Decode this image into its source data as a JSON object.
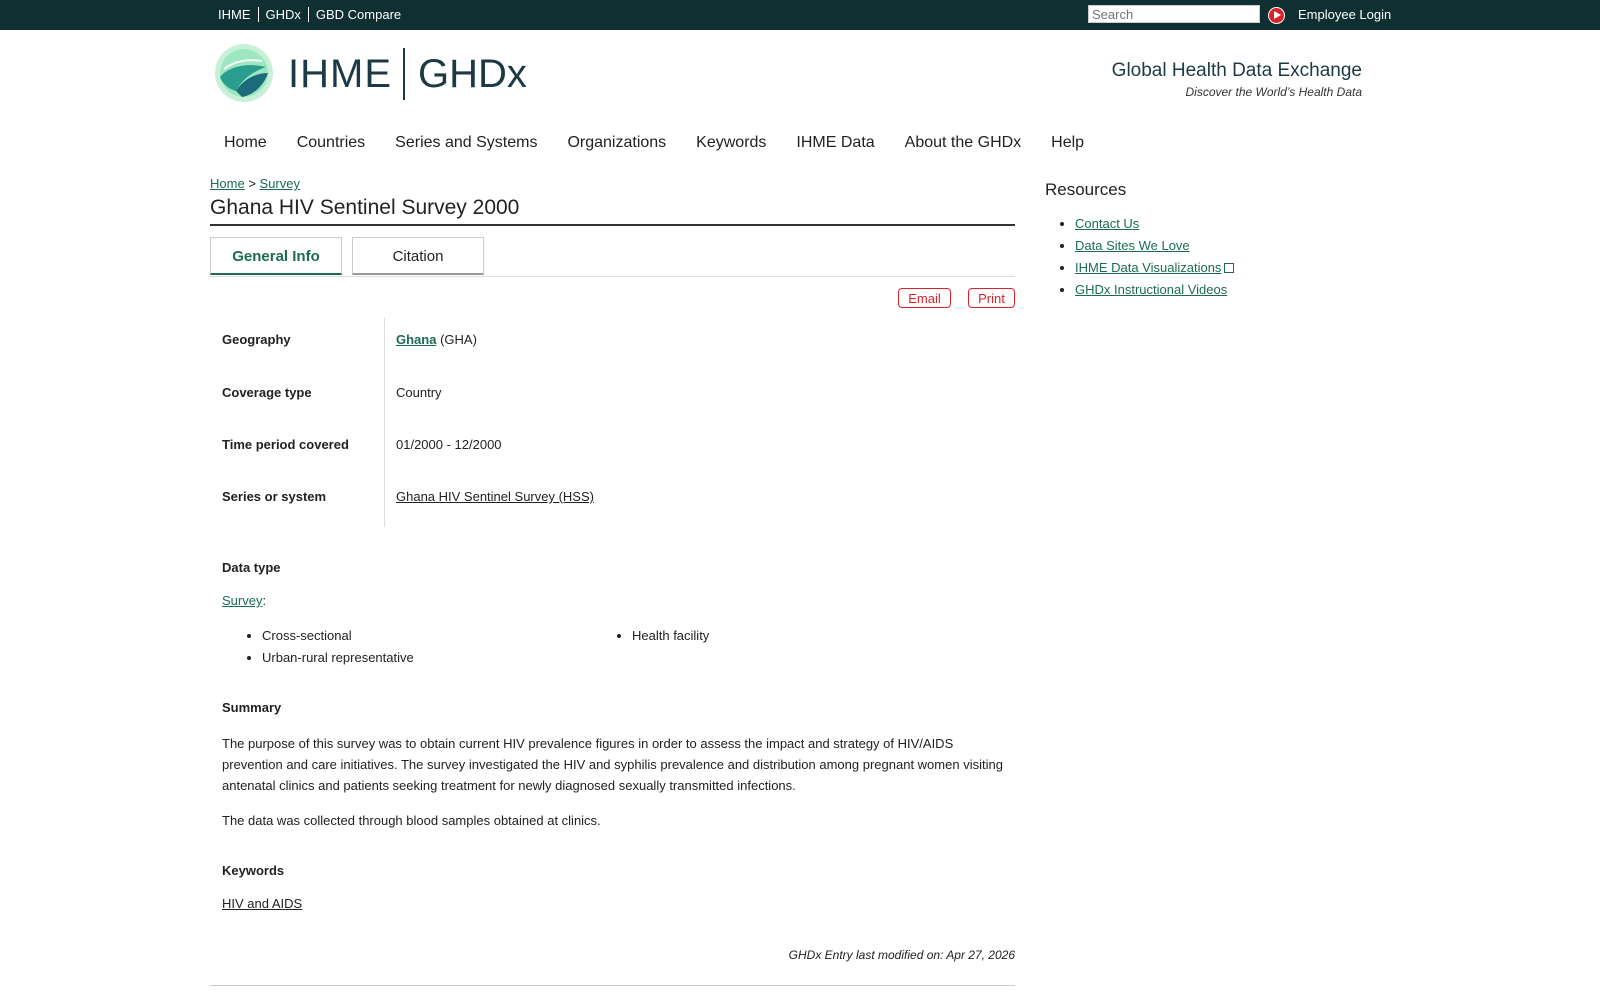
{
  "topbar": {
    "links": [
      "IHME",
      "GHDx",
      "GBD Compare"
    ],
    "search_placeholder": "Search",
    "employee_login": "Employee Login"
  },
  "header": {
    "logo_ihme": "IHME",
    "logo_ghdx": "GHDx",
    "tagline": "Global Health Data Exchange",
    "subtagline": "Discover the World’s Health Data"
  },
  "nav": [
    "Home",
    "Countries",
    "Series and Systems",
    "Organizations",
    "Keywords",
    "IHME Data",
    "About the GHDx",
    "Help"
  ],
  "breadcrumb": {
    "home": "Home",
    "sep": ">",
    "survey": "Survey"
  },
  "page": {
    "title": "Ghana HIV Sentinel Survey 2000"
  },
  "tabs": {
    "general": "General Info",
    "citation": "Citation"
  },
  "actions": {
    "email": "Email",
    "print": "Print"
  },
  "info": {
    "geography_label": "Geography",
    "geography_link": "Ghana",
    "geography_code": " (GHA)",
    "coverage_label": "Coverage type",
    "coverage_value": "Country",
    "time_label": "Time period covered",
    "time_value": "01/2000 - 12/2000",
    "series_label": "Series or system",
    "series_value": "Ghana HIV Sentinel Survey (HSS)"
  },
  "data_type": {
    "label": "Data type",
    "link": "Survey",
    "suffix": ":",
    "col1": [
      "Cross-sectional",
      "Urban-rural representative"
    ],
    "col2": [
      "Health facility"
    ]
  },
  "summary": {
    "label": "Summary",
    "p1": "The purpose of this survey was to obtain current HIV prevalence figures in order to assess the impact and strategy of HIV/AIDS prevention and care initiatives. The survey investigated the HIV and syphilis prevalence and distribution among pregnant women visiting antenatal clinics and patients seeking treatment for newly diagnosed sexually transmitted infections.",
    "p2": "The data was collected through blood samples obtained at clinics."
  },
  "keywords": {
    "label": "Keywords",
    "items": [
      "HIV and AIDS"
    ]
  },
  "footer": {
    "modified": "GHDx Entry last modified on: Apr 27, 2026"
  },
  "resources": {
    "title": "Resources",
    "items": [
      "Contact Us",
      "Data Sites We Love",
      "IHME Data Visualizations",
      "GHDx Instructional Videos"
    ]
  },
  "colors": {
    "topbar": "#0f2f33",
    "link": "#1c6b52",
    "accent_red": "#d8232a"
  }
}
